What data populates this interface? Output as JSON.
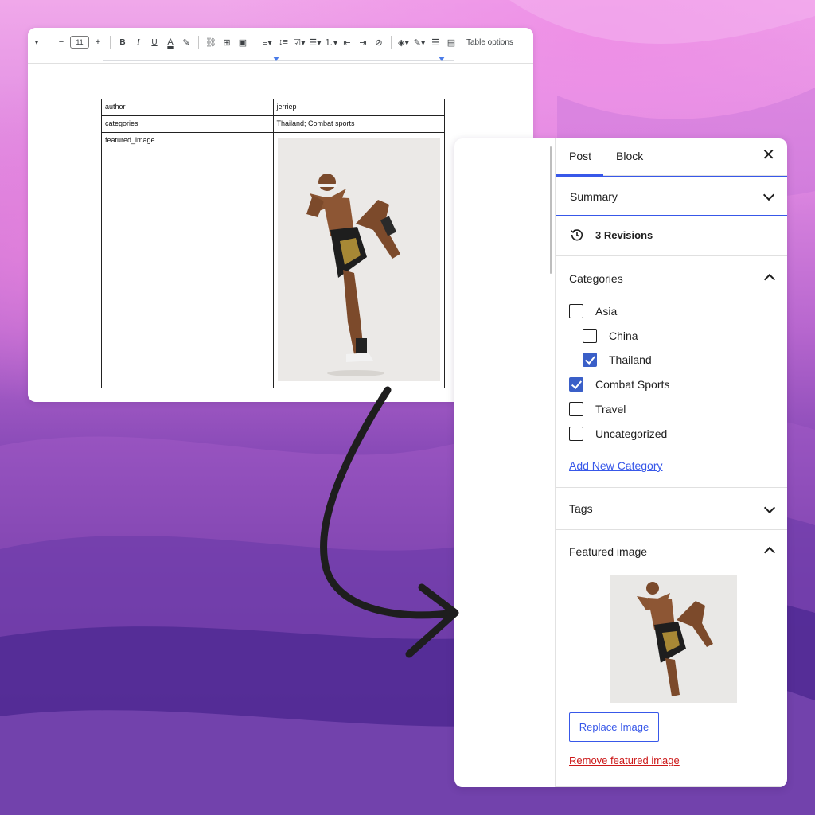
{
  "docs": {
    "toolbar": {
      "font_size": "11",
      "minus": "−",
      "plus": "+",
      "bold": "B",
      "italic": "I",
      "underline": "U",
      "text_color": "A",
      "table_options": "Table options"
    },
    "table": [
      {
        "key": "author",
        "value": "jerriep"
      },
      {
        "key": "categories",
        "value": "Thailand; Combat sports"
      },
      {
        "key": "featured_image",
        "value": ""
      }
    ]
  },
  "wp": {
    "tabs": {
      "post": "Post",
      "block": "Block"
    },
    "summary": "Summary",
    "revisions": "3 Revisions",
    "categories": {
      "title": "Categories",
      "items": [
        {
          "label": "Asia",
          "checked": false,
          "indent": 0
        },
        {
          "label": "China",
          "checked": false,
          "indent": 1
        },
        {
          "label": "Thailand",
          "checked": true,
          "indent": 1
        },
        {
          "label": "Combat Sports",
          "checked": true,
          "indent": 0
        },
        {
          "label": "Travel",
          "checked": false,
          "indent": 0
        },
        {
          "label": "Uncategorized",
          "checked": false,
          "indent": 0
        }
      ],
      "add_new": "Add New Category"
    },
    "tags": "Tags",
    "featured_image": {
      "title": "Featured image",
      "replace": "Replace Image",
      "remove": "Remove featured image"
    }
  },
  "colors": {
    "wp_accent": "#3858e9",
    "checkbox_checked": "#3a5fc8",
    "remove_red": "#cc1818",
    "arrow": "#1e1e1e"
  }
}
